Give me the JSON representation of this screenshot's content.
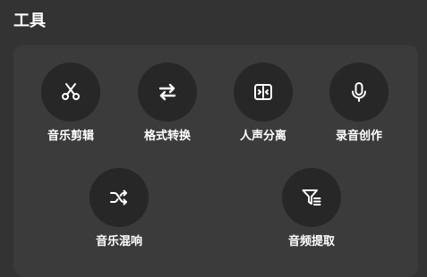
{
  "header": {
    "title": "工具"
  },
  "tools": [
    {
      "label": "音乐剪辑",
      "icon": "scissors-icon"
    },
    {
      "label": "格式转换",
      "icon": "swap-arrows-icon"
    },
    {
      "label": "人声分离",
      "icon": "split-icon"
    },
    {
      "label": "录音创作",
      "icon": "microphone-icon"
    },
    {
      "label": "音乐混响",
      "icon": "shuffle-icon"
    },
    {
      "label": "音频提取",
      "icon": "filter-list-icon"
    }
  ],
  "colors": {
    "background": "#333333",
    "panel": "#3b3b3b",
    "button": "#272727",
    "text": "#ffffff"
  }
}
